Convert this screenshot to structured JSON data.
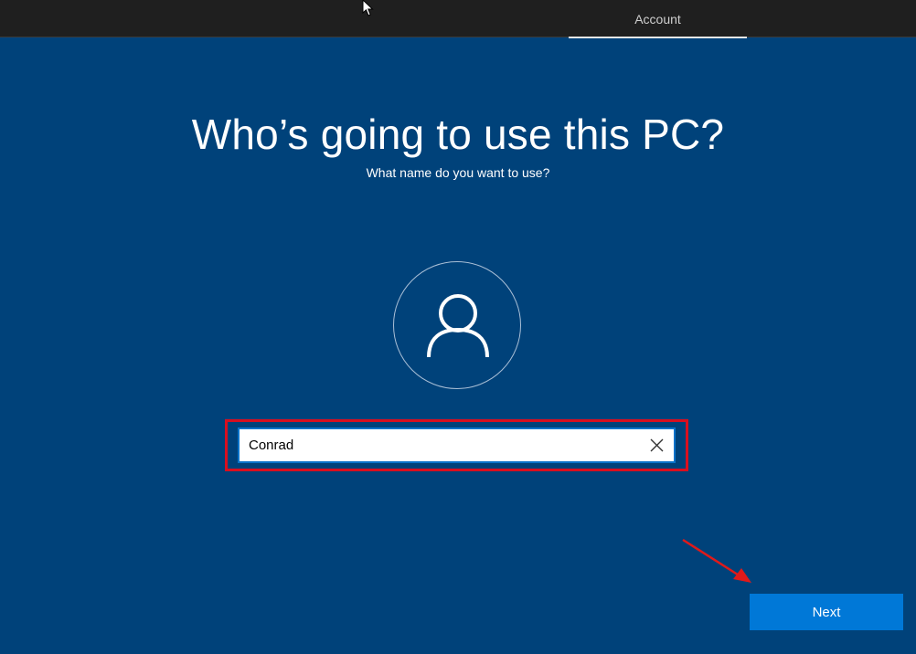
{
  "header": {
    "tab_label": "Account"
  },
  "page": {
    "title": "Who’s going to use this PC?",
    "subtitle": "What name do you want to use?"
  },
  "name_field": {
    "value": "Conrad",
    "clear_icon": "close-icon"
  },
  "actions": {
    "next_label": "Next"
  },
  "icons": {
    "avatar": "user-icon",
    "pointer": "mouse-cursor-icon",
    "annotation": "red-arrow-icon"
  },
  "colors": {
    "background": "#00427a",
    "topbar": "#1f1f1f",
    "accent": "#0078d7",
    "highlight": "#d90f1f"
  }
}
